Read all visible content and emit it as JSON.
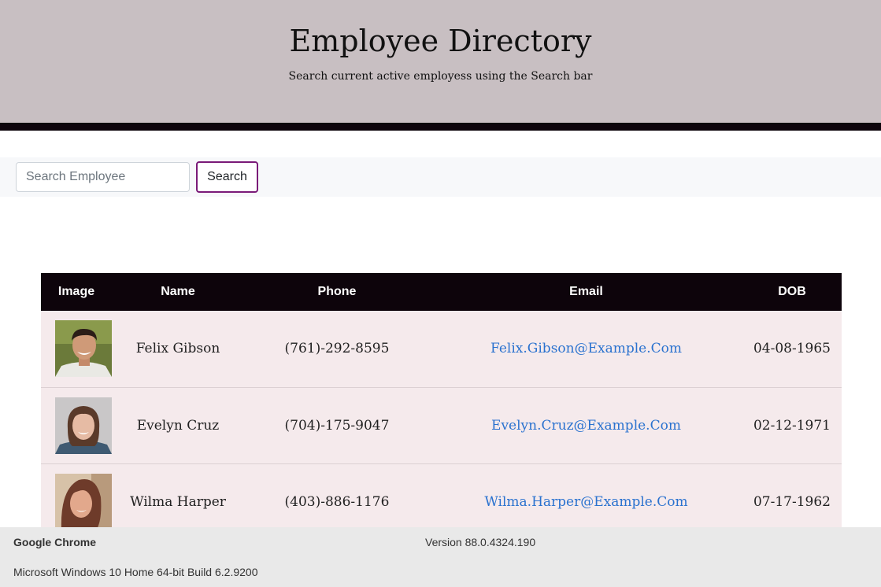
{
  "header": {
    "title": "Employee Directory",
    "subtitle": "Search current active employess using the Search bar"
  },
  "search": {
    "placeholder": "Search Employee",
    "value": "",
    "button_label": "Search",
    "button_border_color": "#7a1a78"
  },
  "table": {
    "headers": [
      "Image",
      "Name",
      "Phone",
      "Email",
      "DOB"
    ],
    "rows": [
      {
        "name": "Felix Gibson",
        "phone": "(761)-292-8595",
        "email": "Felix.Gibson@Example.Com",
        "dob": "04-08-1965"
      },
      {
        "name": "Evelyn Cruz",
        "phone": "(704)-175-9047",
        "email": "Evelyn.Cruz@Example.Com",
        "dob": "02-12-1971"
      },
      {
        "name": "Wilma Harper",
        "phone": "(403)-886-1176",
        "email": "Wilma.Harper@Example.Com",
        "dob": "07-17-1962"
      }
    ]
  },
  "footer": {
    "browser": "Google Chrome",
    "version": "Version 88.0.4324.190",
    "os": "Microsoft Windows 10 Home 64-bit Build 6.2.9200"
  },
  "colors": {
    "header_bg": "#c8bfc2",
    "header_bar": "#0d040b",
    "row_bg": "#f5eaec",
    "link": "#2a72cf"
  }
}
